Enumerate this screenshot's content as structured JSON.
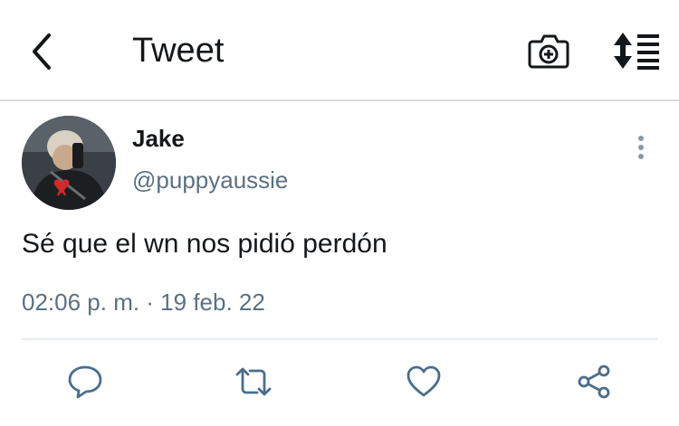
{
  "header": {
    "title": "Tweet",
    "back_icon": "back-arrow-icon",
    "camera_icon": "camera-plus-icon",
    "sort_icon": "sort-list-icon"
  },
  "tweet": {
    "author_name": "Jake",
    "author_handle": "@puppyaussie",
    "text": "Sé que el wn nos pidió perdón",
    "timestamp": "02:06 p. m. · 19 feb. 22"
  },
  "actions": [
    "reply-icon",
    "retweet-icon",
    "like-icon",
    "share-icon"
  ],
  "colors": {
    "text_primary": "#14171a",
    "text_secondary": "#5b7083",
    "icon_gray": "#8899a6",
    "action_blue": "#4a6e8c"
  }
}
